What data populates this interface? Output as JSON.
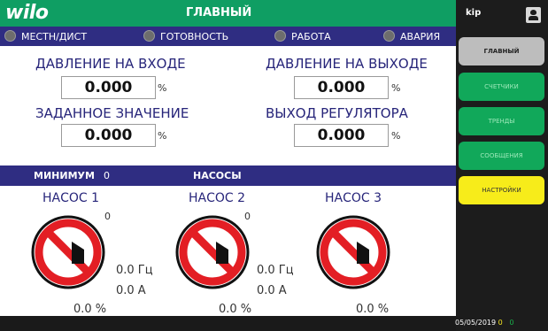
{
  "header": {
    "logo": "wilo",
    "title": "ГЛАВНЫЙ"
  },
  "status": [
    {
      "label": "МЕСТН/ДИСТ"
    },
    {
      "label": "ГОТОВНОСТЬ"
    },
    {
      "label": "РАБОТА"
    },
    {
      "label": "АВАРИЯ"
    }
  ],
  "params": {
    "inlet": {
      "label": "ДАВЛЕНИЕ НА ВХОДЕ",
      "value": "0.000",
      "unit": "%"
    },
    "outlet": {
      "label": "ДАВЛЕНИЕ НА ВЫХОДЕ",
      "value": "0.000",
      "unit": "%"
    },
    "setpoint": {
      "label": "ЗАДАННОЕ ЗНАЧЕНИЕ",
      "value": "0.000",
      "unit": "%"
    },
    "regulator": {
      "label": "ВЫХОД РЕГУЛЯТОРА",
      "value": "0.000",
      "unit": "%"
    }
  },
  "pumps_bar": {
    "min_label": "МИНИМУМ",
    "min_value": "0",
    "title": "НАСОСЫ"
  },
  "pumps": [
    {
      "name": "НАСОС 1",
      "count": "0",
      "freq": "0.0 Гц",
      "current": "0.0 А",
      "percent": "0.0 %"
    },
    {
      "name": "НАСОС 2",
      "count": "0",
      "freq": "0.0 Гц",
      "current": "0.0 А",
      "percent": "0.0 %"
    },
    {
      "name": "НАСОС 3",
      "count": "",
      "freq": "",
      "current": "",
      "percent": "0.0 %"
    }
  ],
  "sidebar": {
    "user": "kip",
    "nav": [
      {
        "label": "ГЛАВНЫЙ"
      },
      {
        "label": "СЧЕТЧИКИ"
      },
      {
        "label": "ТРЕНДЫ"
      },
      {
        "label": "СООБЩЕНИЯ"
      },
      {
        "label": "НАСТРОЙКИ"
      }
    ],
    "footer": {
      "date": "05/05/2019",
      "v1": "0",
      "v2": "0"
    }
  }
}
